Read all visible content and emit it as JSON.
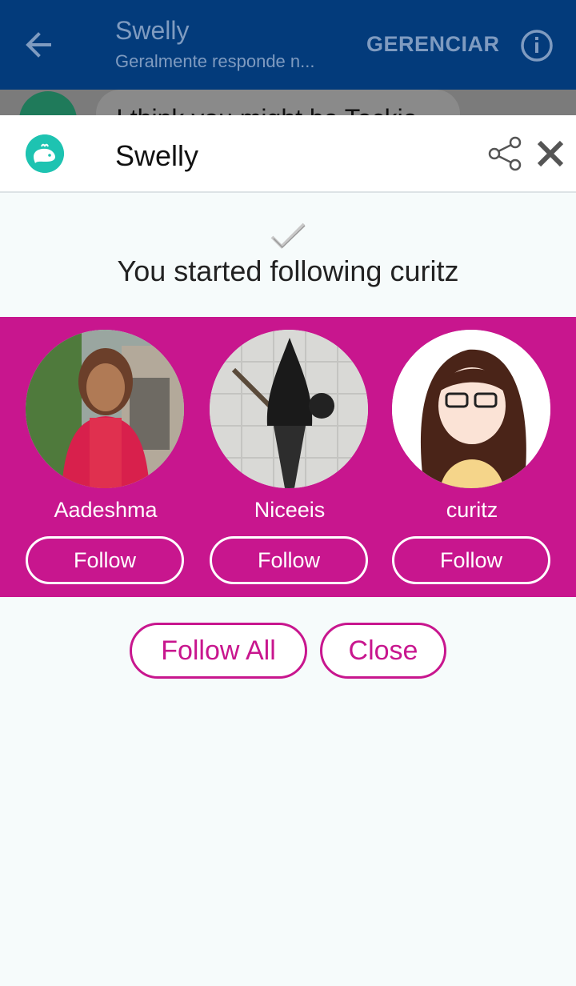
{
  "app_bar": {
    "title": "Swelly",
    "subtitle": "Geralmente responde n...",
    "manage_label": "GERENCIAR",
    "icons": [
      "arrow-left-icon",
      "info-icon"
    ],
    "background": "#033b7b"
  },
  "chat_peek": {
    "text": "I think you might be Teckie"
  },
  "sheet": {
    "title": "Swelly",
    "icons": [
      "whale-logo-icon",
      "share-icon",
      "close-icon"
    ],
    "notice": "You started following curitz",
    "accent": "#c8168e",
    "users": [
      {
        "name": "Aadeshma",
        "follow_label": "Follow"
      },
      {
        "name": "Niceeis",
        "follow_label": "Follow"
      },
      {
        "name": "curitz",
        "follow_label": "Follow"
      }
    ],
    "follow_all_label": "Follow All",
    "close_label": "Close"
  }
}
